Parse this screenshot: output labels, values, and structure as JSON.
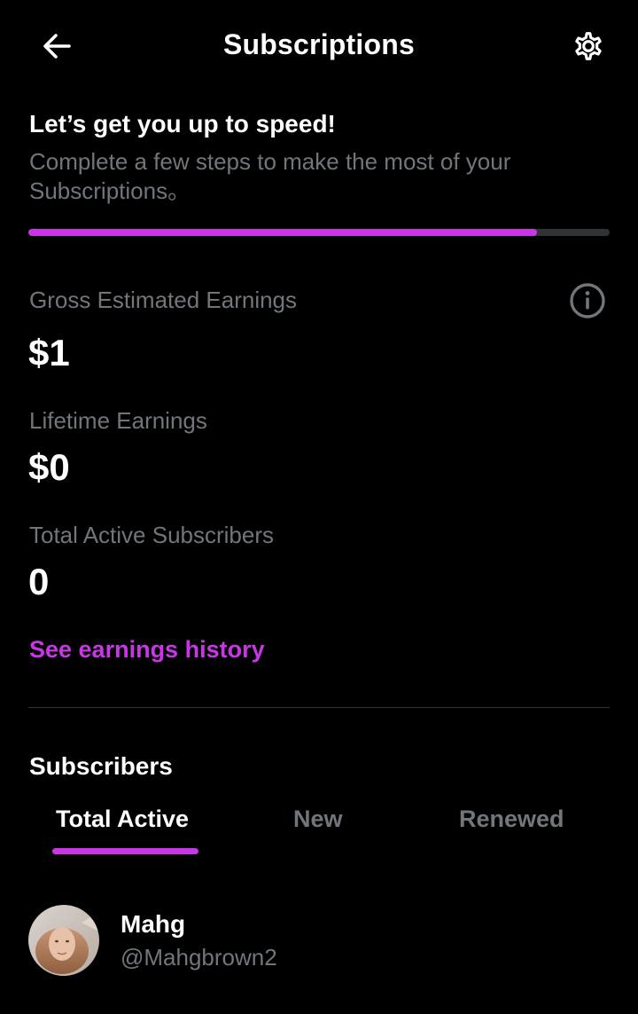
{
  "colors": {
    "background": "#000000",
    "text_primary": "#ffffff",
    "text_secondary": "#71767b",
    "accent": "#c936e6",
    "track": "#2f3336",
    "divider": "#2f3336"
  },
  "header": {
    "title": "Subscriptions",
    "back_icon": "arrow-left-icon",
    "settings_icon": "gear-icon"
  },
  "onboarding": {
    "title": "Let’s get you up to speed!",
    "description": "Complete a few steps to make the most of your Subscriptions。",
    "progress_fraction": 0.875
  },
  "stats": {
    "gross_estimated": {
      "label": "Gross Estimated Earnings",
      "value": "$1",
      "info_icon": "info-icon"
    },
    "lifetime": {
      "label": "Lifetime Earnings",
      "value": "$0"
    },
    "active_subscribers": {
      "label": "Total Active Subscribers",
      "value": "0"
    }
  },
  "earnings_history_link": "See earnings history",
  "subscribers": {
    "title": "Subscribers",
    "tabs": [
      {
        "label": "Total Active",
        "active": true
      },
      {
        "label": "New",
        "active": false
      },
      {
        "label": "Renewed",
        "active": false
      }
    ],
    "list": [
      {
        "name": "Mahg",
        "handle": "@Mahgbrown2"
      }
    ]
  }
}
